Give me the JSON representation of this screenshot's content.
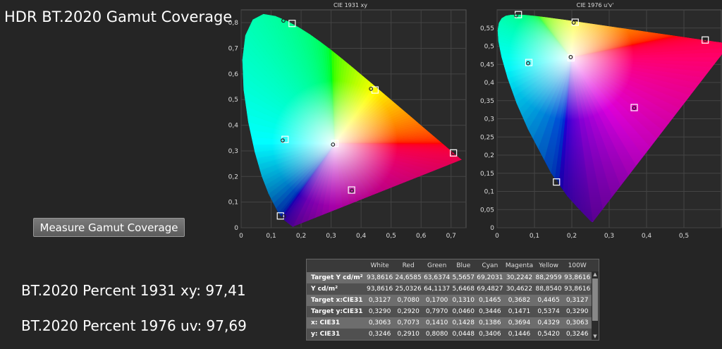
{
  "title": "HDR BT.2020  Gamut Coverage",
  "measure_button": "Measure Gamut Coverage",
  "results": {
    "xy": "BT.2020 Percent 1931 xy: 97,41",
    "uv": "BT.2020 Percent 1976 uv: 97,69"
  },
  "chart_data": [
    {
      "type": "scatter",
      "title": "CIE 1931 xy",
      "xlim": [
        0,
        0.75
      ],
      "ylim": [
        0,
        0.85
      ],
      "x_ticks": [
        "0",
        "0,1",
        "0,2",
        "0,3",
        "0,4",
        "0,5",
        "0,6",
        "0,7"
      ],
      "y_ticks": [
        "0",
        "0,1",
        "0,2",
        "0,3",
        "0,4",
        "0,5",
        "0,6",
        "0,7",
        "0,8"
      ],
      "grid": true,
      "series": [
        {
          "points": [
            {
              "x": 0.708,
              "y": 0.292
            },
            {
              "x": 0.17,
              "y": 0.797
            },
            {
              "x": 0.131,
              "y": 0.046
            },
            {
              "x": 0.1465,
              "y": 0.3446
            },
            {
              "x": 0.3682,
              "y": 0.1471
            },
            {
              "x": 0.4465,
              "y": 0.5374
            },
            {
              "x": 0.3127,
              "y": 0.329
            }
          ]
        },
        {
          "points": [
            {
              "x": 0.7073,
              "y": 0.291
            },
            {
              "x": 0.141,
              "y": 0.808
            },
            {
              "x": 0.1428,
              "y": 0.0448
            },
            {
              "x": 0.1386,
              "y": 0.3406
            },
            {
              "x": 0.3694,
              "y": 0.1446
            },
            {
              "x": 0.4329,
              "y": 0.542
            },
            {
              "x": 0.3063,
              "y": 0.3246
            }
          ]
        }
      ]
    },
    {
      "type": "scatter",
      "title": "CIE 1976 u'v'",
      "xlim": [
        0,
        0.6
      ],
      "ylim": [
        0,
        0.6
      ],
      "x_ticks": [
        "0",
        "0,1",
        "0,2",
        "0,3",
        "0,4",
        "0,5"
      ],
      "y_ticks": [
        "0",
        "0,05",
        "0,1",
        "0,15",
        "0,2",
        "0,25",
        "0,3",
        "0,35",
        "0,4",
        "0,45",
        "0,5",
        "0,55"
      ],
      "grid": true,
      "series": [
        {
          "points": [
            {
              "x": 0.557,
              "y": 0.517
            },
            {
              "x": 0.057,
              "y": 0.587
            },
            {
              "x": 0.159,
              "y": 0.126
            },
            {
              "x": 0.085,
              "y": 0.455
            },
            {
              "x": 0.367,
              "y": 0.331
            },
            {
              "x": 0.209,
              "y": 0.566
            },
            {
              "x": 0.198,
              "y": 0.468
            }
          ]
        },
        {
          "points": [
            {
              "x": 0.557,
              "y": 0.517
            },
            {
              "x": 0.051,
              "y": 0.585
            },
            {
              "x": 0.159,
              "y": 0.126
            },
            {
              "x": 0.083,
              "y": 0.453
            },
            {
              "x": 0.367,
              "y": 0.33
            },
            {
              "x": 0.205,
              "y": 0.565
            },
            {
              "x": 0.197,
              "y": 0.47
            }
          ]
        }
      ]
    }
  ],
  "table": {
    "columns": [
      "",
      "White",
      "Red",
      "Green",
      "Blue",
      "Cyan",
      "Magenta",
      "Yellow",
      "100W"
    ],
    "rows": [
      [
        "Target Y cd/m²",
        "93,8616",
        "24,6585",
        "63,6374",
        "5,5657",
        "69,2031",
        "30,2242",
        "88,2959",
        "93,8616"
      ],
      [
        "Y cd/m²",
        "93,8616",
        "25,0326",
        "64,1137",
        "5,6468",
        "69,4827",
        "30,4622",
        "88,8540",
        "93,8616"
      ],
      [
        "Target x:CIE31",
        "0,3127",
        "0,7080",
        "0,1700",
        "0,1310",
        "0,1465",
        "0,3682",
        "0,4465",
        "0,3127"
      ],
      [
        "Target y:CIE31",
        "0,3290",
        "0,2920",
        "0,7970",
        "0,0460",
        "0,3446",
        "0,1471",
        "0,5374",
        "0,3290"
      ],
      [
        "x: CIE31",
        "0,3063",
        "0,7073",
        "0,1410",
        "0,1428",
        "0,1386",
        "0,3694",
        "0,4329",
        "0,3063"
      ],
      [
        "y: CIE31",
        "0,3246",
        "0,2910",
        "0,8080",
        "0,0448",
        "0,3406",
        "0,1446",
        "0,5420",
        "0,3246"
      ]
    ]
  }
}
